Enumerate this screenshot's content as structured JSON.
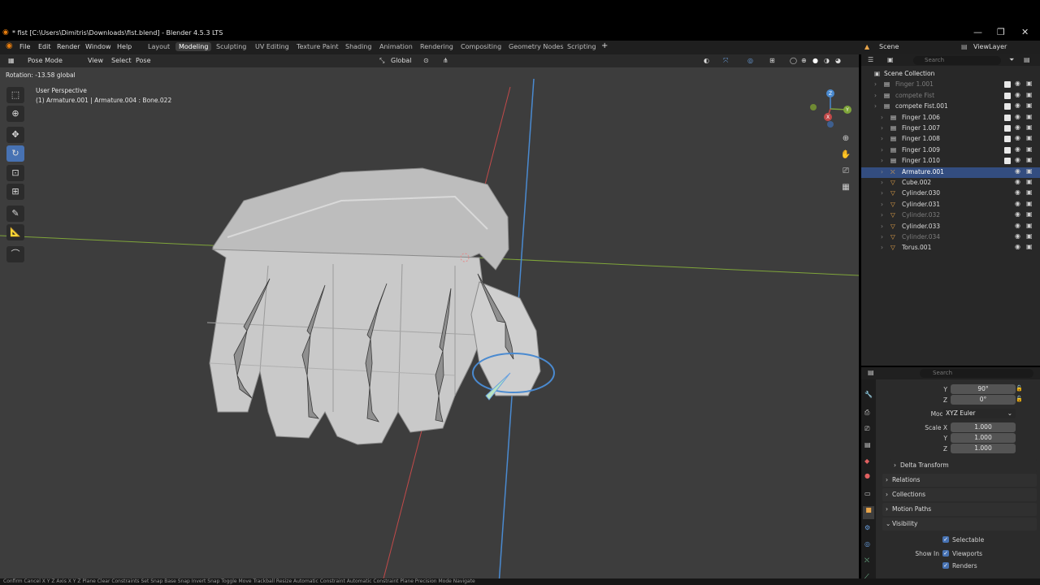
{
  "window": {
    "title": "* fist [C:\\Users\\Dimitris\\Downloads\\fist.blend] - Blender 4.5.3 LTS",
    "controls": [
      "—",
      "❐",
      "✕"
    ]
  },
  "menubar": {
    "menus": [
      "File",
      "Edit",
      "Render",
      "Window",
      "Help"
    ],
    "workspaces": [
      "Layout",
      "Modeling",
      "Sculpting",
      "UV Editing",
      "Texture Paint",
      "Shading",
      "Animation",
      "Rendering",
      "Compositing",
      "Geometry Nodes",
      "Scripting"
    ],
    "active_workspace": "Modeling",
    "add_tab": "+",
    "scene": "Scene",
    "view_layer": "ViewLayer"
  },
  "viewport": {
    "mode": "Pose Mode",
    "menus": [
      "View",
      "Select",
      "Pose"
    ],
    "orientation": "Global",
    "operator_text": "Rotation: -13.58 global",
    "view_name": "User Perspective",
    "object_info": "(1) Armature.001 | Armature.004 : Bone.022",
    "gizmo_axes": [
      "X",
      "Y",
      "Z"
    ]
  },
  "outliner": {
    "search_placeholder": "Search",
    "root": "Scene Collection",
    "items": [
      {
        "name": "Finger 1.001",
        "dim": true,
        "check": true
      },
      {
        "name": "compete Fist",
        "dim": true,
        "check": true
      },
      {
        "name": "compete Fist.001",
        "dim": false,
        "check": true
      },
      {
        "name": "Finger 1.006",
        "dim": false,
        "check": true
      },
      {
        "name": "Finger 1.007",
        "dim": false,
        "check": true
      },
      {
        "name": "Finger 1.008",
        "dim": false,
        "check": true
      },
      {
        "name": "Finger 1.009",
        "dim": false,
        "check": true
      },
      {
        "name": "Finger 1.010",
        "dim": false,
        "check": true
      },
      {
        "name": "Armature.001",
        "dim": false,
        "check": false,
        "selected": true
      },
      {
        "name": "Cube.002",
        "dim": false,
        "check": false
      },
      {
        "name": "Cylinder.030",
        "dim": false,
        "check": false
      },
      {
        "name": "Cylinder.031",
        "dim": false,
        "check": false
      },
      {
        "name": "Cylinder.032",
        "dim": true,
        "check": false
      },
      {
        "name": "Cylinder.033",
        "dim": false,
        "check": false
      },
      {
        "name": "Cylinder.034",
        "dim": true,
        "check": false
      },
      {
        "name": "Torus.001",
        "dim": false,
        "check": false
      }
    ]
  },
  "properties": {
    "search_placeholder": "Search",
    "rotation_y": "90°",
    "rotation_z": "0°",
    "label_y": "Y",
    "label_z": "Z",
    "mode_label": "Mode",
    "mode_value": "XYZ Euler",
    "scale_label": "Scale X",
    "scale_x": "1.000",
    "scale_y": "1.000",
    "scale_z": "1.000",
    "delta_transform": "Delta Transform",
    "relations": "Relations",
    "collections": "Collections",
    "motion_paths": "Motion Paths",
    "visibility": "Visibility",
    "selectable": "Selectable",
    "show_in": "Show In",
    "viewports": "Viewports",
    "renders": "Renders"
  },
  "statusbar": {
    "text": "Confirm   Cancel   X Y Z Axis   X Y Z Plane   Clear Constraints   Set Snap Base   Snap Invert   Snap Toggle   Move   Trackball   Resize   Automatic Constraint   Automatic Constraint Plane   Precision Mode   Navigate"
  },
  "colors": {
    "accent": "#4772b3",
    "viewport_bg": "#3d3d3d",
    "panel_bg": "#282828",
    "x_axis": "#c24a4a",
    "y_axis": "#7fa53a",
    "z_axis": "#4a8ad0"
  }
}
